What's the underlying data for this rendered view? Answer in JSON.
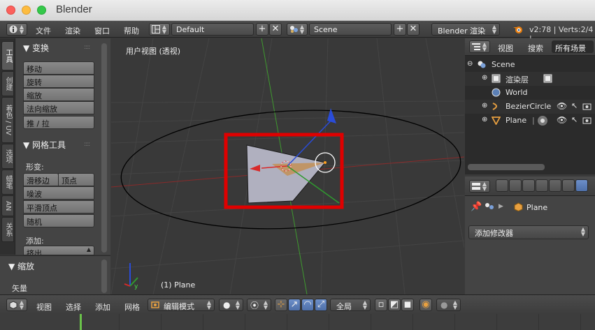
{
  "window": {
    "title": "Blender"
  },
  "topbar": {
    "menus": [
      "文件",
      "渲染",
      "窗口",
      "帮助"
    ],
    "screen_layout": "Default",
    "scene": "Scene",
    "engine": "Blender 渲染",
    "version_stats": "v2:78 | Verts:2/4 |"
  },
  "tabs": [
    "工具",
    "创建",
    "着色 / UV",
    "选项",
    "蜡笔",
    "AN",
    "关系"
  ],
  "toolshelf": {
    "transform_header": "▼ 变换",
    "transform_buttons": [
      "移动",
      "旋转",
      "缩放",
      "法向缩放",
      "推 / 拉"
    ],
    "mesh_tools_header": "▼ 网格工具",
    "deform_label": "形变:",
    "slide_edge": "滑移边",
    "vertex": "顶点",
    "noise": "噪波",
    "smooth_vertex": "平滑顶点",
    "random": "随机",
    "add_label": "添加:",
    "extrude": "挤出"
  },
  "operator_panel": {
    "header": "▼ 缩放",
    "vector_label": "矢量"
  },
  "viewport": {
    "view_label": "用户视图 (透视)",
    "object_label": "(1) Plane",
    "highlight_color": "#e00000"
  },
  "outliner": {
    "header_menus": [
      "视图",
      "搜索"
    ],
    "filter": "所有场景",
    "rows": [
      "Scene",
      "渲染层",
      "World",
      "BezierCircle",
      "Plane"
    ]
  },
  "properties": {
    "object_name": "Plane",
    "add_modifier": "添加修改器"
  },
  "bottombar": {
    "menus": [
      "视图",
      "选择",
      "添加",
      "网格"
    ],
    "mode": "编辑模式",
    "orientation": "全局"
  }
}
